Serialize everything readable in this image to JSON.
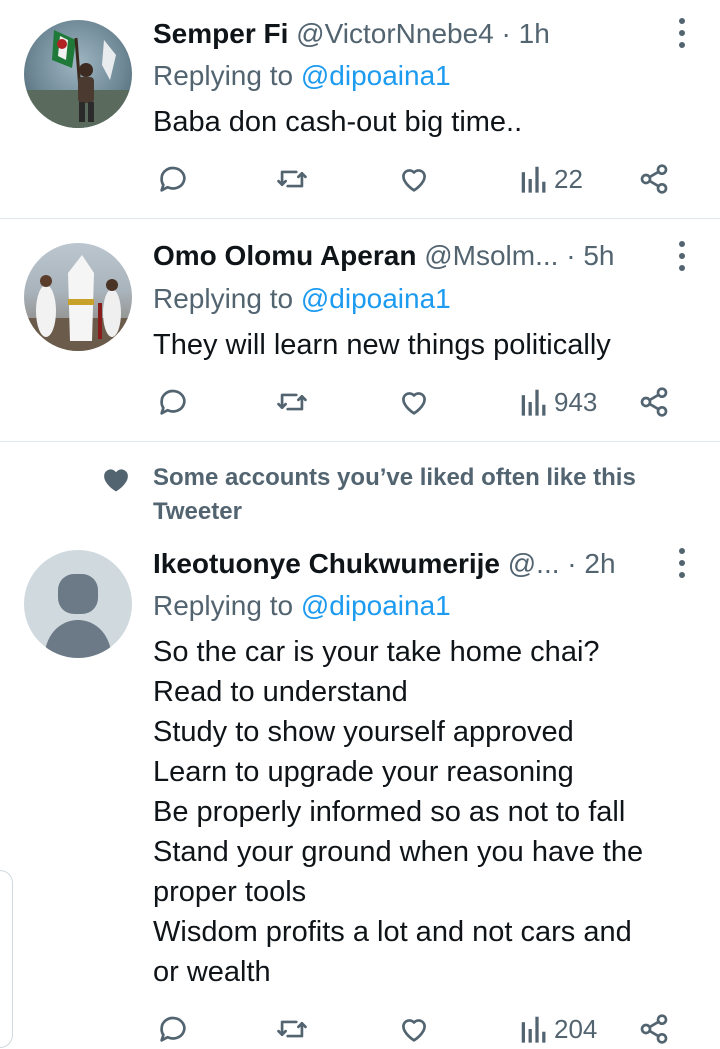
{
  "tweets": [
    {
      "name": "Semper Fi",
      "handle": "@VictorNnebe4",
      "separator": "·",
      "time": "1h",
      "reply_prefix": "Replying to",
      "reply_mention": "@dipoaina1",
      "lines": [
        "Baba don cash-out big time.."
      ],
      "views": "22"
    },
    {
      "name": "Omo Olomu Aperan",
      "handle": "@Msolm...",
      "separator": "·",
      "time": "5h",
      "reply_prefix": "Replying to",
      "reply_mention": "@dipoaina1",
      "lines": [
        "They will learn new things politically"
      ],
      "views": "943"
    },
    {
      "social_context": "Some accounts you’ve liked often like this Tweeter",
      "name": "Ikeotuonye Chukwumerije",
      "handle": "@...",
      "separator": "·",
      "time": "2h",
      "reply_prefix": "Replying to",
      "reply_mention": "@dipoaina1",
      "lines": [
        "So the car is your take home chai?",
        "Read to understand",
        "Study to show yourself approved",
        "Learn to upgrade your reasoning",
        "Be properly informed so as not to fall",
        "Stand your ground when you have the",
        "proper tools",
        "Wisdom profits a lot and not cars and",
        "or wealth"
      ],
      "views": "204"
    }
  ],
  "icons": {
    "reply": "reply-icon",
    "retweet": "retweet-icon",
    "like": "heart-icon",
    "views": "views-icon",
    "share": "share-icon",
    "more": "more-icon",
    "social": "heart-icon"
  },
  "colors": {
    "text": "#0f1419",
    "secondary": "#536471",
    "mention": "#1d9bf0",
    "divider": "#e1e8ed"
  }
}
